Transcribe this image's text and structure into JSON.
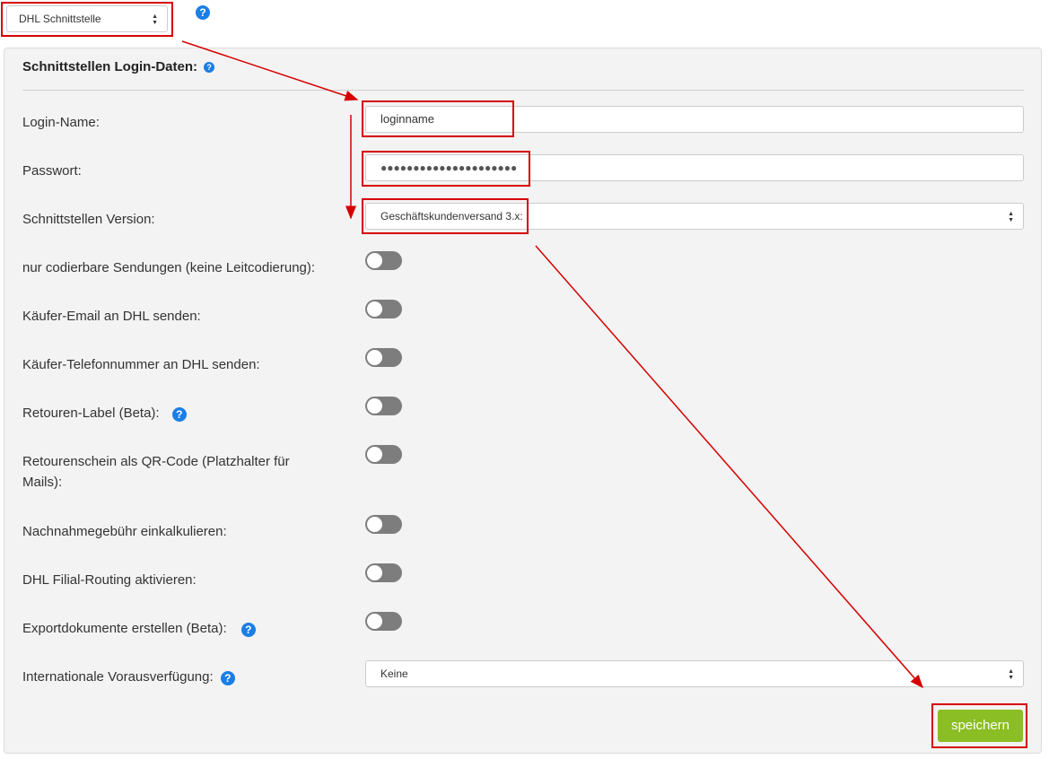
{
  "top": {
    "interface_select": "DHL Schnittstelle",
    "help": "?"
  },
  "panel": {
    "title": "Schnittstellen Login-Daten:",
    "help": "?",
    "fields": {
      "login_label": "Login-Name:",
      "login_value": "loginname",
      "password_label": "Passwort:",
      "password_value": "●●●●●●●●●●●●●●●●●●●●●",
      "version_label": "Schnittstellen Version:",
      "version_value": "Geschäftskundenversand 3.x:",
      "intl_label": "Internationale Vorausverfügung:",
      "intl_value": "Keine"
    },
    "toggles": [
      {
        "label": "nur codierbare Sendungen (keine Leitcodierung):",
        "on": false
      },
      {
        "label": "Käufer-Email an DHL senden:",
        "on": false
      },
      {
        "label": "Käufer-Telefonnummer an DHL senden:",
        "on": false
      },
      {
        "label": "Retouren-Label (Beta):",
        "on": false,
        "help": "?"
      },
      {
        "label": "Retourenschein als QR-Code (Platzhalter für Mails):",
        "on": false
      },
      {
        "label": "Nachnahmegebühr einkalkulieren:",
        "on": false
      },
      {
        "label": "DHL Filial-Routing aktivieren:",
        "on": false
      },
      {
        "label": "Exportdokumente erstellen (Beta):",
        "on": false,
        "help": "?"
      }
    ],
    "save_label": "speichern"
  },
  "colors": {
    "accent_green": "#8bbd24",
    "help_blue": "#1a7ee6",
    "annotation_red": "#d60000"
  }
}
